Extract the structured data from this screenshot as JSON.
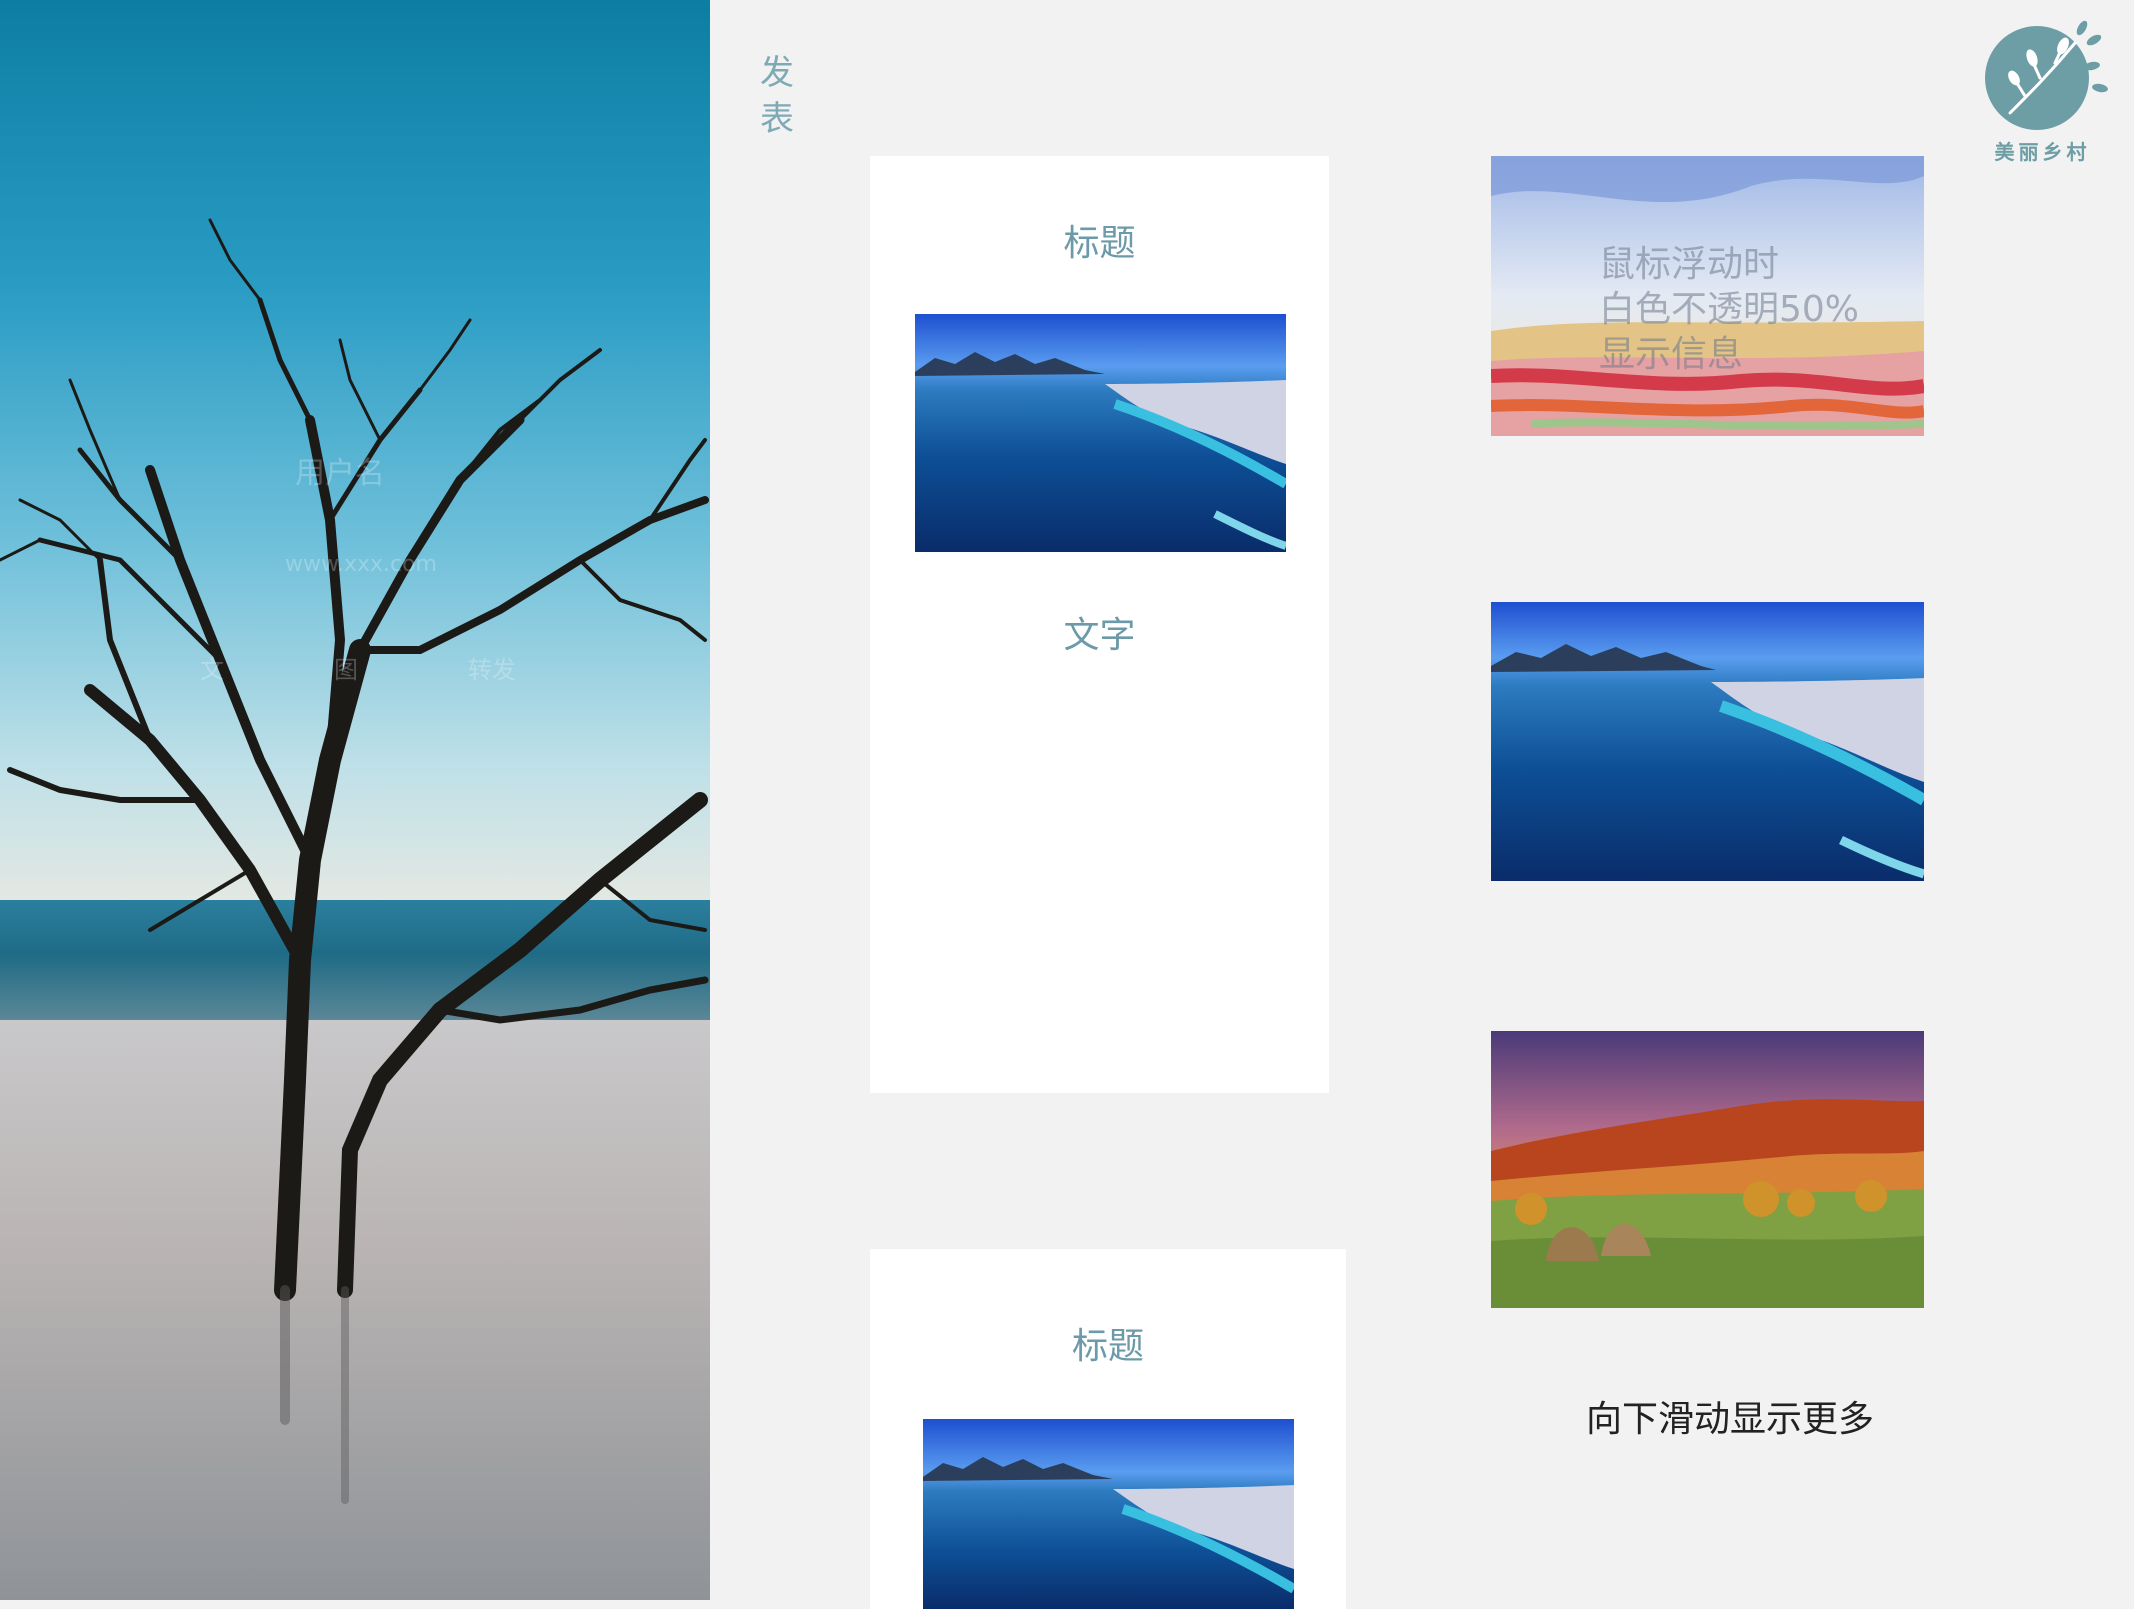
{
  "sidebar": {
    "user_name": "用户名",
    "user_site": "www.xxx.com",
    "nav": [
      "文",
      "图",
      "转发"
    ]
  },
  "publish": {
    "chars": [
      "发",
      "表"
    ]
  },
  "logo": {
    "text": "美丽乡村"
  },
  "posts": [
    {
      "title": "标题",
      "text": "文字"
    },
    {
      "title": "标题"
    }
  ],
  "gallery": {
    "hover_lines": [
      "鼠标浮动时",
      "白色不透明50%",
      "显示信息"
    ]
  },
  "scroll_hint": "向下滑动显示更多",
  "colors": {
    "accent": "#7eaab6",
    "background": "#f2f2f2",
    "card": "#ffffff"
  }
}
